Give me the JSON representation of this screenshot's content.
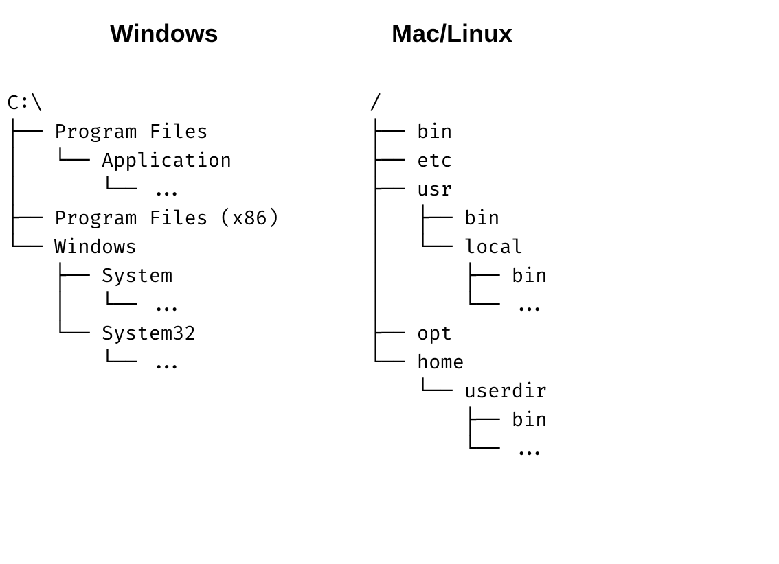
{
  "headings": {
    "windows": "Windows",
    "unix": "Mac/Linux"
  },
  "windows_tree": {
    "root": "C:\\",
    "l0": "├── Program Files",
    "l1": "│   └── Application",
    "l2": "│       └── ...",
    "l3": "├── Program Files (x86)",
    "l4": "└── Windows",
    "l5": "    ├── System",
    "l6": "    │   └── ...",
    "l7": "    └── System32",
    "l8": "        └── ..."
  },
  "unix_tree": {
    "root": "/",
    "l0": "├── bin",
    "l1": "├── etc",
    "l2": "├── usr",
    "l3": "│   ├── bin",
    "l4": "│   └── local",
    "l5": "│       ├── bin",
    "l6": "│       └── ...",
    "l7": "├── opt",
    "l8": "└── home",
    "l9": "    └── userdir",
    "l10": "        ├── bin",
    "l11": "        └── ..."
  }
}
